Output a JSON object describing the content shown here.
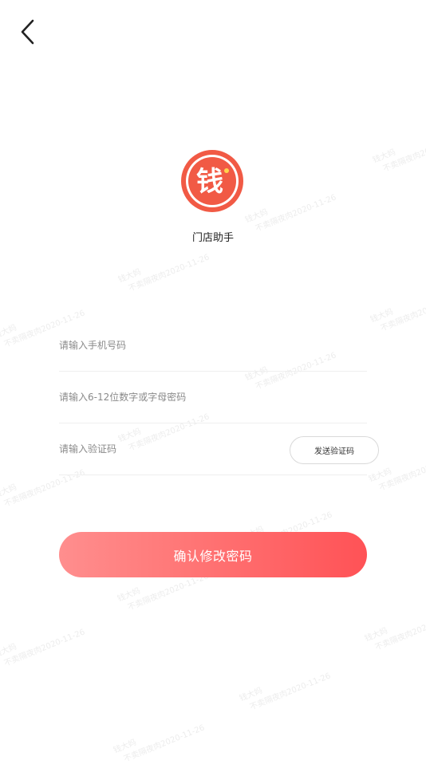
{
  "app": {
    "name": "门店助手",
    "logo_char": "钱",
    "brand_color": "#f15a45"
  },
  "icons": {
    "back": "chevron-left-icon"
  },
  "form": {
    "phone_placeholder": "请输入手机号码",
    "password_placeholder": "请输入6-12位数字或字母密码",
    "code_placeholder": "请输入验证码",
    "send_code_label": "发送验证码",
    "submit_label": "确认修改密码"
  },
  "watermark": {
    "line1": "钱大妈",
    "line2": "不卖隔夜肉2020-11-26"
  }
}
